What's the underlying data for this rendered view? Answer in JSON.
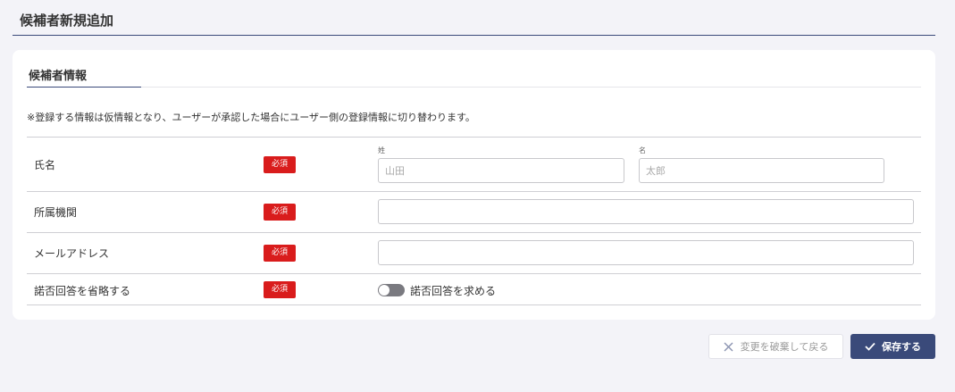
{
  "page": {
    "title": "候補者新規追加"
  },
  "section": {
    "title": "候補者情報"
  },
  "notice": "※登録する情報は仮情報となり、ユーザーが承認した場合にユーザー側の登録情報に切り替わります。",
  "required_badge": "必須",
  "form": {
    "name": {
      "label": "氏名",
      "last_label": "姓",
      "last_placeholder": "山田",
      "first_label": "名",
      "first_placeholder": "太郎"
    },
    "affiliation": {
      "label": "所属機関",
      "value": ""
    },
    "email": {
      "label": "メールアドレス",
      "value": ""
    },
    "skip_response": {
      "label": "諾否回答を省略する",
      "toggle_label": "諾否回答を求める",
      "enabled": false
    }
  },
  "actions": {
    "cancel_label": "変更を破棄して戻る",
    "save_label": "保存する"
  },
  "colors": {
    "accent": "#3a4a7a",
    "required": "#d91c1c",
    "background": "#f3f3f8"
  },
  "icons": {
    "cancel": "close-icon",
    "save": "check-icon"
  }
}
